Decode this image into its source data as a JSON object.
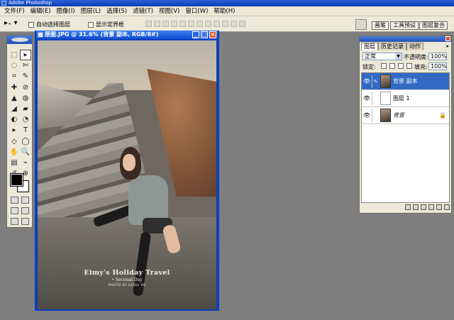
{
  "app": {
    "title": "Adobe Photoshop"
  },
  "menu": [
    "文件(F)",
    "编辑(E)",
    "图像(I)",
    "图层(L)",
    "选择(S)",
    "滤镜(T)",
    "视图(V)",
    "窗口(W)",
    "帮助(H)"
  ],
  "options": {
    "tool_glyph": "▸₊ ▾",
    "auto_select_label": "自动选择图层",
    "show_bounds_label": "显示定界框",
    "tabs": [
      "画笔",
      "工具预设",
      "图层复合"
    ]
  },
  "document": {
    "title": "原图.JPG @ 31.6% (背景 副本, RGB/8#)",
    "watermark": {
      "line1": "Eimy's Holiday Travel",
      "line2": "• Seconal Day",
      "line3": "PHOTO BY GUOLI 09"
    }
  },
  "toolbox": {
    "tools": [
      "⬚",
      "▸",
      "◌",
      "✄",
      "⌗",
      "✎",
      "✚",
      "⊘",
      "▲",
      "◍",
      "◢",
      "▰",
      "◐",
      "◔",
      "▸",
      "T",
      "◇",
      "◯",
      "✋",
      "🔍",
      "▤",
      "⌁",
      "✐",
      "⊕"
    ]
  },
  "layers_panel": {
    "tabs": [
      "图层",
      "历史记录",
      "动作"
    ],
    "blend_mode": "正常",
    "opacity_label": "不透明度:",
    "opacity": "100%",
    "lock_label": "锁定:",
    "fill_label": "填充:",
    "fill": "100%",
    "layers": [
      {
        "name": "背景 副本",
        "selected": true,
        "brush": "✎"
      },
      {
        "name": "图层 1",
        "selected": false,
        "brush": ""
      },
      {
        "name": "背景",
        "selected": false,
        "brush": ""
      }
    ],
    "eye_glyph": "👁",
    "lock_glyph": "🔒"
  }
}
